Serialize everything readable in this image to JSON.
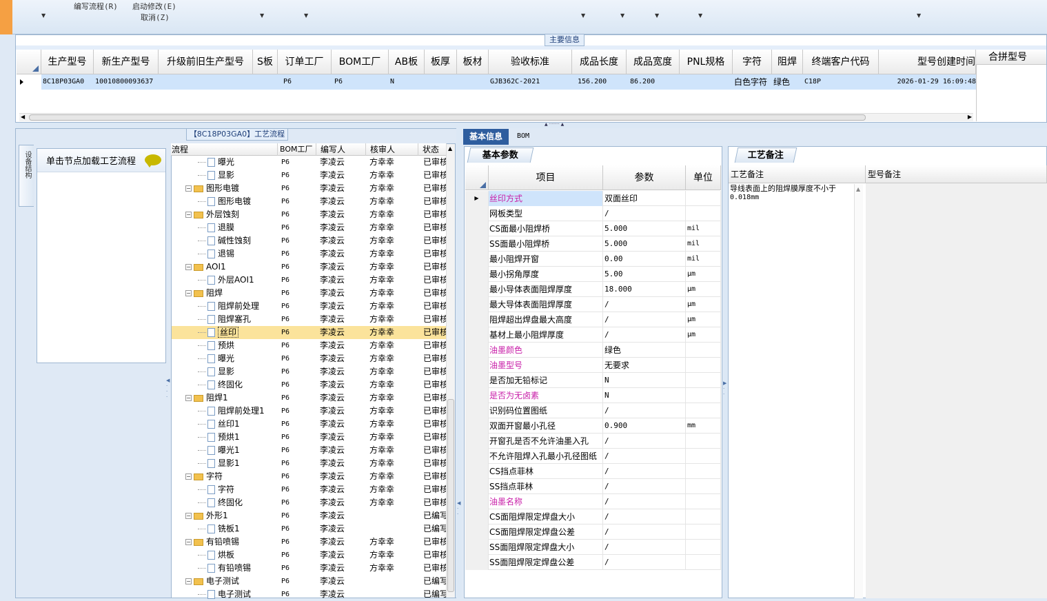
{
  "toolbar": {
    "items": [
      {
        "label": "编写流程(R)"
      },
      {
        "label": "启动修改(E)"
      },
      {
        "label": "取消(Z)"
      }
    ]
  },
  "main_info": {
    "title": "主要信息",
    "columns": [
      "生产型号",
      "新生产型号",
      "升级前旧生产型号",
      "S板",
      "订单工厂",
      "BOM工厂",
      "AB板",
      "板厚",
      "板材",
      "验收标准",
      "成品长度",
      "成品宽度",
      "PNL规格",
      "字符",
      "阻焊",
      "终端客户代码",
      "型号创建时间"
    ],
    "row": [
      "8C18P03GA0",
      "10010800093637",
      "",
      "",
      "P6",
      "P6",
      "N",
      "",
      "",
      "GJB362C-2021",
      "156.200",
      "86.200",
      "",
      "白色字符",
      "绿色",
      "C18P",
      "2026-01-29 16:09:48"
    ],
    "merge_header": "合拼型号"
  },
  "process_panel": {
    "title": "【8C18P03GA0】工艺流程",
    "vertical_tab": "设备结构",
    "load_text": "单击节点加载工艺流程",
    "tree_columns": [
      "流程",
      "BOM工厂",
      "编写人",
      "核审人",
      "状态"
    ],
    "rows": [
      {
        "name": "曝光",
        "bom": "P6",
        "writer": "李凌云",
        "reviewer": "方幸幸",
        "status": "已审核",
        "level": 2
      },
      {
        "name": "显影",
        "bom": "P6",
        "writer": "李凌云",
        "reviewer": "方幸幸",
        "status": "已审核",
        "level": 2
      },
      {
        "name": "图形电镀",
        "bom": "P6",
        "writer": "李凌云",
        "reviewer": "方幸幸",
        "status": "已审核",
        "level": 1
      },
      {
        "name": "图形电镀",
        "bom": "P6",
        "writer": "李凌云",
        "reviewer": "方幸幸",
        "status": "已审核",
        "level": 2
      },
      {
        "name": "外层蚀刻",
        "bom": "P6",
        "writer": "李凌云",
        "reviewer": "方幸幸",
        "status": "已审核",
        "level": 1
      },
      {
        "name": "退膜",
        "bom": "P6",
        "writer": "李凌云",
        "reviewer": "方幸幸",
        "status": "已审核",
        "level": 2
      },
      {
        "name": "碱性蚀刻",
        "bom": "P6",
        "writer": "李凌云",
        "reviewer": "方幸幸",
        "status": "已审核",
        "level": 2
      },
      {
        "name": "退锡",
        "bom": "P6",
        "writer": "李凌云",
        "reviewer": "方幸幸",
        "status": "已审核",
        "level": 2
      },
      {
        "name": "AOI1",
        "bom": "P6",
        "writer": "李凌云",
        "reviewer": "方幸幸",
        "status": "已审核",
        "level": 1
      },
      {
        "name": "外层AOI1",
        "bom": "P6",
        "writer": "李凌云",
        "reviewer": "方幸幸",
        "status": "已审核",
        "level": 2
      },
      {
        "name": "阻焊",
        "bom": "P6",
        "writer": "李凌云",
        "reviewer": "方幸幸",
        "status": "已审核",
        "level": 1
      },
      {
        "name": "阻焊前处理",
        "bom": "P6",
        "writer": "李凌云",
        "reviewer": "方幸幸",
        "status": "已审核",
        "level": 2
      },
      {
        "name": "阻焊塞孔",
        "bom": "P6",
        "writer": "李凌云",
        "reviewer": "方幸幸",
        "status": "已审核",
        "level": 2
      },
      {
        "name": "丝印",
        "bom": "P6",
        "writer": "李凌云",
        "reviewer": "方幸幸",
        "status": "已审核",
        "level": 2,
        "selected": true
      },
      {
        "name": "预烘",
        "bom": "P6",
        "writer": "李凌云",
        "reviewer": "方幸幸",
        "status": "已审核",
        "level": 2
      },
      {
        "name": "曝光",
        "bom": "P6",
        "writer": "李凌云",
        "reviewer": "方幸幸",
        "status": "已审核",
        "level": 2
      },
      {
        "name": "显影",
        "bom": "P6",
        "writer": "李凌云",
        "reviewer": "方幸幸",
        "status": "已审核",
        "level": 2
      },
      {
        "name": "终固化",
        "bom": "P6",
        "writer": "李凌云",
        "reviewer": "方幸幸",
        "status": "已审核",
        "level": 2
      },
      {
        "name": "阻焊1",
        "bom": "P6",
        "writer": "李凌云",
        "reviewer": "方幸幸",
        "status": "已审核",
        "level": 1
      },
      {
        "name": "阻焊前处理1",
        "bom": "P6",
        "writer": "李凌云",
        "reviewer": "方幸幸",
        "status": "已审核",
        "level": 2
      },
      {
        "name": "丝印1",
        "bom": "P6",
        "writer": "李凌云",
        "reviewer": "方幸幸",
        "status": "已审核",
        "level": 2
      },
      {
        "name": "预烘1",
        "bom": "P6",
        "writer": "李凌云",
        "reviewer": "方幸幸",
        "status": "已审核",
        "level": 2
      },
      {
        "name": "曝光1",
        "bom": "P6",
        "writer": "李凌云",
        "reviewer": "方幸幸",
        "status": "已审核",
        "level": 2
      },
      {
        "name": "显影1",
        "bom": "P6",
        "writer": "李凌云",
        "reviewer": "方幸幸",
        "status": "已审核",
        "level": 2
      },
      {
        "name": "字符",
        "bom": "P6",
        "writer": "李凌云",
        "reviewer": "方幸幸",
        "status": "已审核",
        "level": 1
      },
      {
        "name": "字符",
        "bom": "P6",
        "writer": "李凌云",
        "reviewer": "方幸幸",
        "status": "已审核",
        "level": 2
      },
      {
        "name": "终固化",
        "bom": "P6",
        "writer": "李凌云",
        "reviewer": "方幸幸",
        "status": "已审核",
        "level": 2
      },
      {
        "name": "外形1",
        "bom": "P6",
        "writer": "李凌云",
        "reviewer": "",
        "status": "已编写",
        "level": 1
      },
      {
        "name": "铣板1",
        "bom": "P6",
        "writer": "李凌云",
        "reviewer": "",
        "status": "已编写",
        "level": 2
      },
      {
        "name": "有铅喷锡",
        "bom": "P6",
        "writer": "李凌云",
        "reviewer": "方幸幸",
        "status": "已审核",
        "level": 1
      },
      {
        "name": "烘板",
        "bom": "P6",
        "writer": "李凌云",
        "reviewer": "方幸幸",
        "status": "已审核",
        "level": 2
      },
      {
        "name": "有铅喷锡",
        "bom": "P6",
        "writer": "李凌云",
        "reviewer": "方幸幸",
        "status": "已审核",
        "level": 2
      },
      {
        "name": "电子测试",
        "bom": "P6",
        "writer": "李凌云",
        "reviewer": "",
        "status": "已编写",
        "level": 1
      },
      {
        "name": "电子测试",
        "bom": "P6",
        "writer": "李凌云",
        "reviewer": "",
        "status": "已编写",
        "level": 2
      }
    ]
  },
  "tabs": [
    {
      "label": "基本信息"
    },
    {
      "label": "BOM"
    }
  ],
  "params": {
    "tab_label": "基本参数",
    "columns": [
      "项目",
      "参数",
      "单位"
    ],
    "rows": [
      {
        "item": "丝印方式",
        "value": "双面丝印",
        "unit": "",
        "pink": true,
        "selected": true
      },
      {
        "item": "网板类型",
        "value": "/",
        "unit": ""
      },
      {
        "item": "CS面最小阻焊桥",
        "value": "5.000",
        "unit": "mil"
      },
      {
        "item": "SS面最小阻焊桥",
        "value": "5.000",
        "unit": "mil"
      },
      {
        "item": "最小阻焊开窗",
        "value": "0.00",
        "unit": "mil"
      },
      {
        "item": "最小拐角厚度",
        "value": "5.00",
        "unit": "μm"
      },
      {
        "item": "最小导体表面阻焊厚度",
        "value": "18.000",
        "unit": "μm"
      },
      {
        "item": "最大导体表面阻焊厚度",
        "value": "/",
        "unit": "μm"
      },
      {
        "item": "阻焊超出焊盘最大高度",
        "value": "/",
        "unit": "μm"
      },
      {
        "item": "基材上最小阻焊厚度",
        "value": "/",
        "unit": "μm"
      },
      {
        "item": "油墨颜色",
        "value": "绿色",
        "unit": "",
        "pink": true
      },
      {
        "item": "油墨型号",
        "value": "无要求",
        "unit": "",
        "pink": true
      },
      {
        "item": "是否加无铅标记",
        "value": "N",
        "unit": ""
      },
      {
        "item": "是否为无卤素",
        "value": "N",
        "unit": "",
        "pink": true
      },
      {
        "item": "识别码位置图纸",
        "value": "/",
        "unit": ""
      },
      {
        "item": "双面开窗最小孔径",
        "value": "0.900",
        "unit": "mm"
      },
      {
        "item": "开窗孔是否不允许油墨入孔",
        "value": "/",
        "unit": ""
      },
      {
        "item": "不允许阻焊入孔最小孔径图纸",
        "value": "/",
        "unit": ""
      },
      {
        "item": "CS挡点菲林",
        "value": "/",
        "unit": ""
      },
      {
        "item": "SS挡点菲林",
        "value": "/",
        "unit": ""
      },
      {
        "item": "油墨名称",
        "value": "/",
        "unit": "",
        "pink": true
      },
      {
        "item": "CS面阻焊限定焊盘大小",
        "value": "/",
        "unit": ""
      },
      {
        "item": "CS面阻焊限定焊盘公差",
        "value": "/",
        "unit": ""
      },
      {
        "item": "SS面阻焊限定焊盘大小",
        "value": "/",
        "unit": ""
      },
      {
        "item": "SS面阻焊限定焊盘公差",
        "value": "/",
        "unit": ""
      }
    ]
  },
  "notes": {
    "tab_label": "工艺备注",
    "columns": [
      "工艺备注",
      "型号备注"
    ],
    "note_line1": "导线表面上的阻焊膜厚度不小于",
    "note_line2": "0.018mm"
  },
  "colors": {
    "accent": "#2e5d9e",
    "pink": "#c81ea8",
    "selection": "#fbe39b",
    "row_highlight": "#cfe4fb"
  }
}
